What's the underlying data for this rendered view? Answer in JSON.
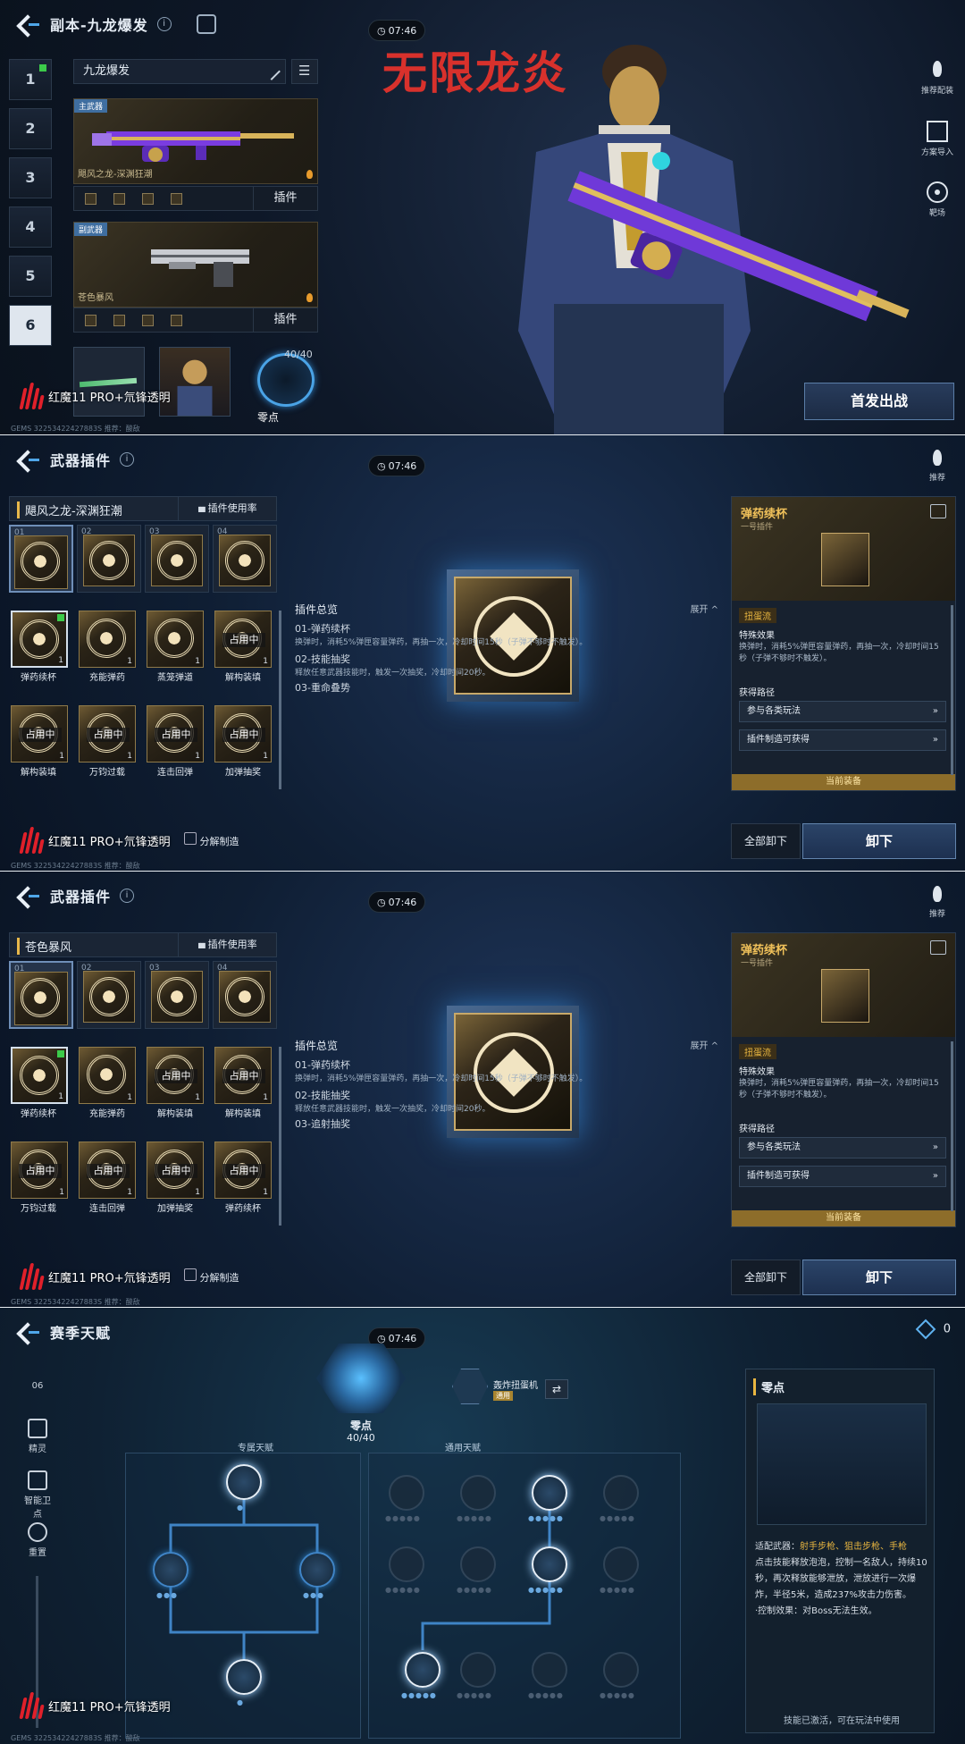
{
  "p1": {
    "title": "副本-九龙爆发",
    "timer": "07:46",
    "tabs": [
      "1",
      "2",
      "3",
      "4",
      "5",
      "6"
    ],
    "loadout_name": "九龙爆发",
    "overlay_title": "无限龙炎",
    "primary": {
      "tag": "主武器",
      "name": "飓风之龙-深渊狂潮",
      "plugin_btn": "插件"
    },
    "secondary": {
      "tag": "副武器",
      "name": "苍色暴风",
      "plugin_btn": "插件"
    },
    "ammo": "40/40",
    "zero_label": "零点",
    "side": [
      "推荐配装",
      "方案导入",
      "靶场"
    ],
    "deploy": "首发出战",
    "gems": "GEMS 32253422427883S 推荐：酸敌"
  },
  "p2": {
    "title": "武器插件",
    "timer": "07:46",
    "weapon": "飓风之龙-深渊狂潮",
    "usage": "插件使用率",
    "slot_nums": [
      "01",
      "02",
      "03",
      "04"
    ],
    "tiles": [
      {
        "label": "弹药续杯",
        "count": "1",
        "occupied": ""
      },
      {
        "label": "充能弹药",
        "count": "1",
        "occupied": ""
      },
      {
        "label": "蒸笼弹道",
        "count": "1",
        "occupied": ""
      },
      {
        "label": "解构装填",
        "count": "1",
        "occupied": "占用中"
      },
      {
        "label": "解构装填",
        "count": "1",
        "occupied": "占用中"
      },
      {
        "label": "万钧过载",
        "count": "1",
        "occupied": "占用中"
      },
      {
        "label": "连击回弹",
        "count": "1",
        "occupied": "占用中"
      },
      {
        "label": "加弹抽奖",
        "count": "1",
        "occupied": "占用中"
      }
    ],
    "summary": {
      "title": "插件总览",
      "expand": "展开 ^",
      "l1": "01-弹药续杯",
      "d1": "换弹时，消耗5%弹匣容量弹药，再抽一次，冷却时间15秒（子弹不够时不触发）。",
      "l2": "02-技能抽奖",
      "d2": "释放任意武器技能时，触发一次抽奖，冷却时间20秒。",
      "l3": "03-重命叠势"
    },
    "dismantle": "分解制造",
    "detail": {
      "name": "弹药续杯",
      "sub": "一号插件",
      "tag": "扭蛋流",
      "sec1": "特殊效果",
      "txt1": "换弹时，消耗5%弹匣容量弹药，再抽一次，冷却时间15秒（子弹不够时不触发）。",
      "sec2": "获得路径",
      "row1": "参与各类玩法",
      "row2": "插件制造可获得",
      "current": "当前装备"
    },
    "unload_all": "全部卸下",
    "unload": "卸下",
    "push": "推荐",
    "gems": "GEMS 32253422427883S 推荐：酸敌"
  },
  "p3": {
    "title": "武器插件",
    "timer": "07:46",
    "weapon": "苍色暴风",
    "usage": "插件使用率",
    "slot_nums": [
      "01",
      "02",
      "03",
      "04"
    ],
    "tiles": [
      {
        "label": "弹药续杯",
        "count": "1",
        "occupied": ""
      },
      {
        "label": "充能弹药",
        "count": "1",
        "occupied": ""
      },
      {
        "label": "解构装填",
        "count": "1",
        "occupied": "占用中"
      },
      {
        "label": "解构装填",
        "count": "1",
        "occupied": "占用中"
      },
      {
        "label": "万钧过载",
        "count": "1",
        "occupied": "占用中"
      },
      {
        "label": "连击回弹",
        "count": "1",
        "occupied": "占用中"
      },
      {
        "label": "加弹抽奖",
        "count": "1",
        "occupied": "占用中"
      },
      {
        "label": "弹药续杯",
        "count": "1",
        "occupied": "占用中"
      }
    ],
    "summary": {
      "title": "插件总览",
      "expand": "展开 ^",
      "l1": "01-弹药续杯",
      "d1": "换弹时，消耗5%弹匣容量弹药，再抽一次，冷却时间15秒（子弹不够时不触发）。",
      "l2": "02-技能抽奖",
      "d2": "释放任意武器技能时，触发一次抽奖，冷却时间20秒。",
      "l3": "03-追射抽奖"
    },
    "dismantle": "分解制造",
    "detail": {
      "name": "弹药续杯",
      "sub": "一号插件",
      "tag": "扭蛋流",
      "sec1": "特殊效果",
      "txt1": "换弹时，消耗5%弹匣容量弹药，再抽一次，冷却时间15秒（子弹不够时不触发）。",
      "sec2": "获得路径",
      "row1": "参与各类玩法",
      "row2": "插件制造可获得",
      "current": "当前装备"
    },
    "unload_all": "全部卸下",
    "unload": "卸下",
    "push": "推荐",
    "gems": "GEMS 32253422427883S 推荐：酸敌"
  },
  "p4": {
    "title": "赛季天赋",
    "timer": "07:46",
    "coins": "0",
    "level": "06",
    "nav": [
      "精灵",
      "智能卫点",
      "重置"
    ],
    "core_name": "零点",
    "core_value": "40/40",
    "minor_name": "轰炸扭蛋机",
    "minor_tag": "通用",
    "tree_left": "专属天赋",
    "tree_right": "通用天赋",
    "card": {
      "title": "零点",
      "desc_a": "适配武器：",
      "desc_b": "射手步枪、狙击步枪、手枪",
      "desc_c": "点击技能释放泡泡，控制一名敌人，持续10秒，再次释放能够泄放，泄放进行一次爆炸，半径5米，造成237%攻击力伤害。",
      "desc_d": "·控制效果：对Boss无法生效。",
      "footer": "技能已激活，可在玩法中使用"
    },
    "gems": "GEMS 32253422427883S 推荐：酸敌"
  },
  "watermark": "红魔11 PRO+氘锋透明",
  "colors": {
    "accent_gold": "#e9b640",
    "accent_blue": "#4aa3e6",
    "brand_red": "#e0202a",
    "title_red": "#d8312c"
  }
}
